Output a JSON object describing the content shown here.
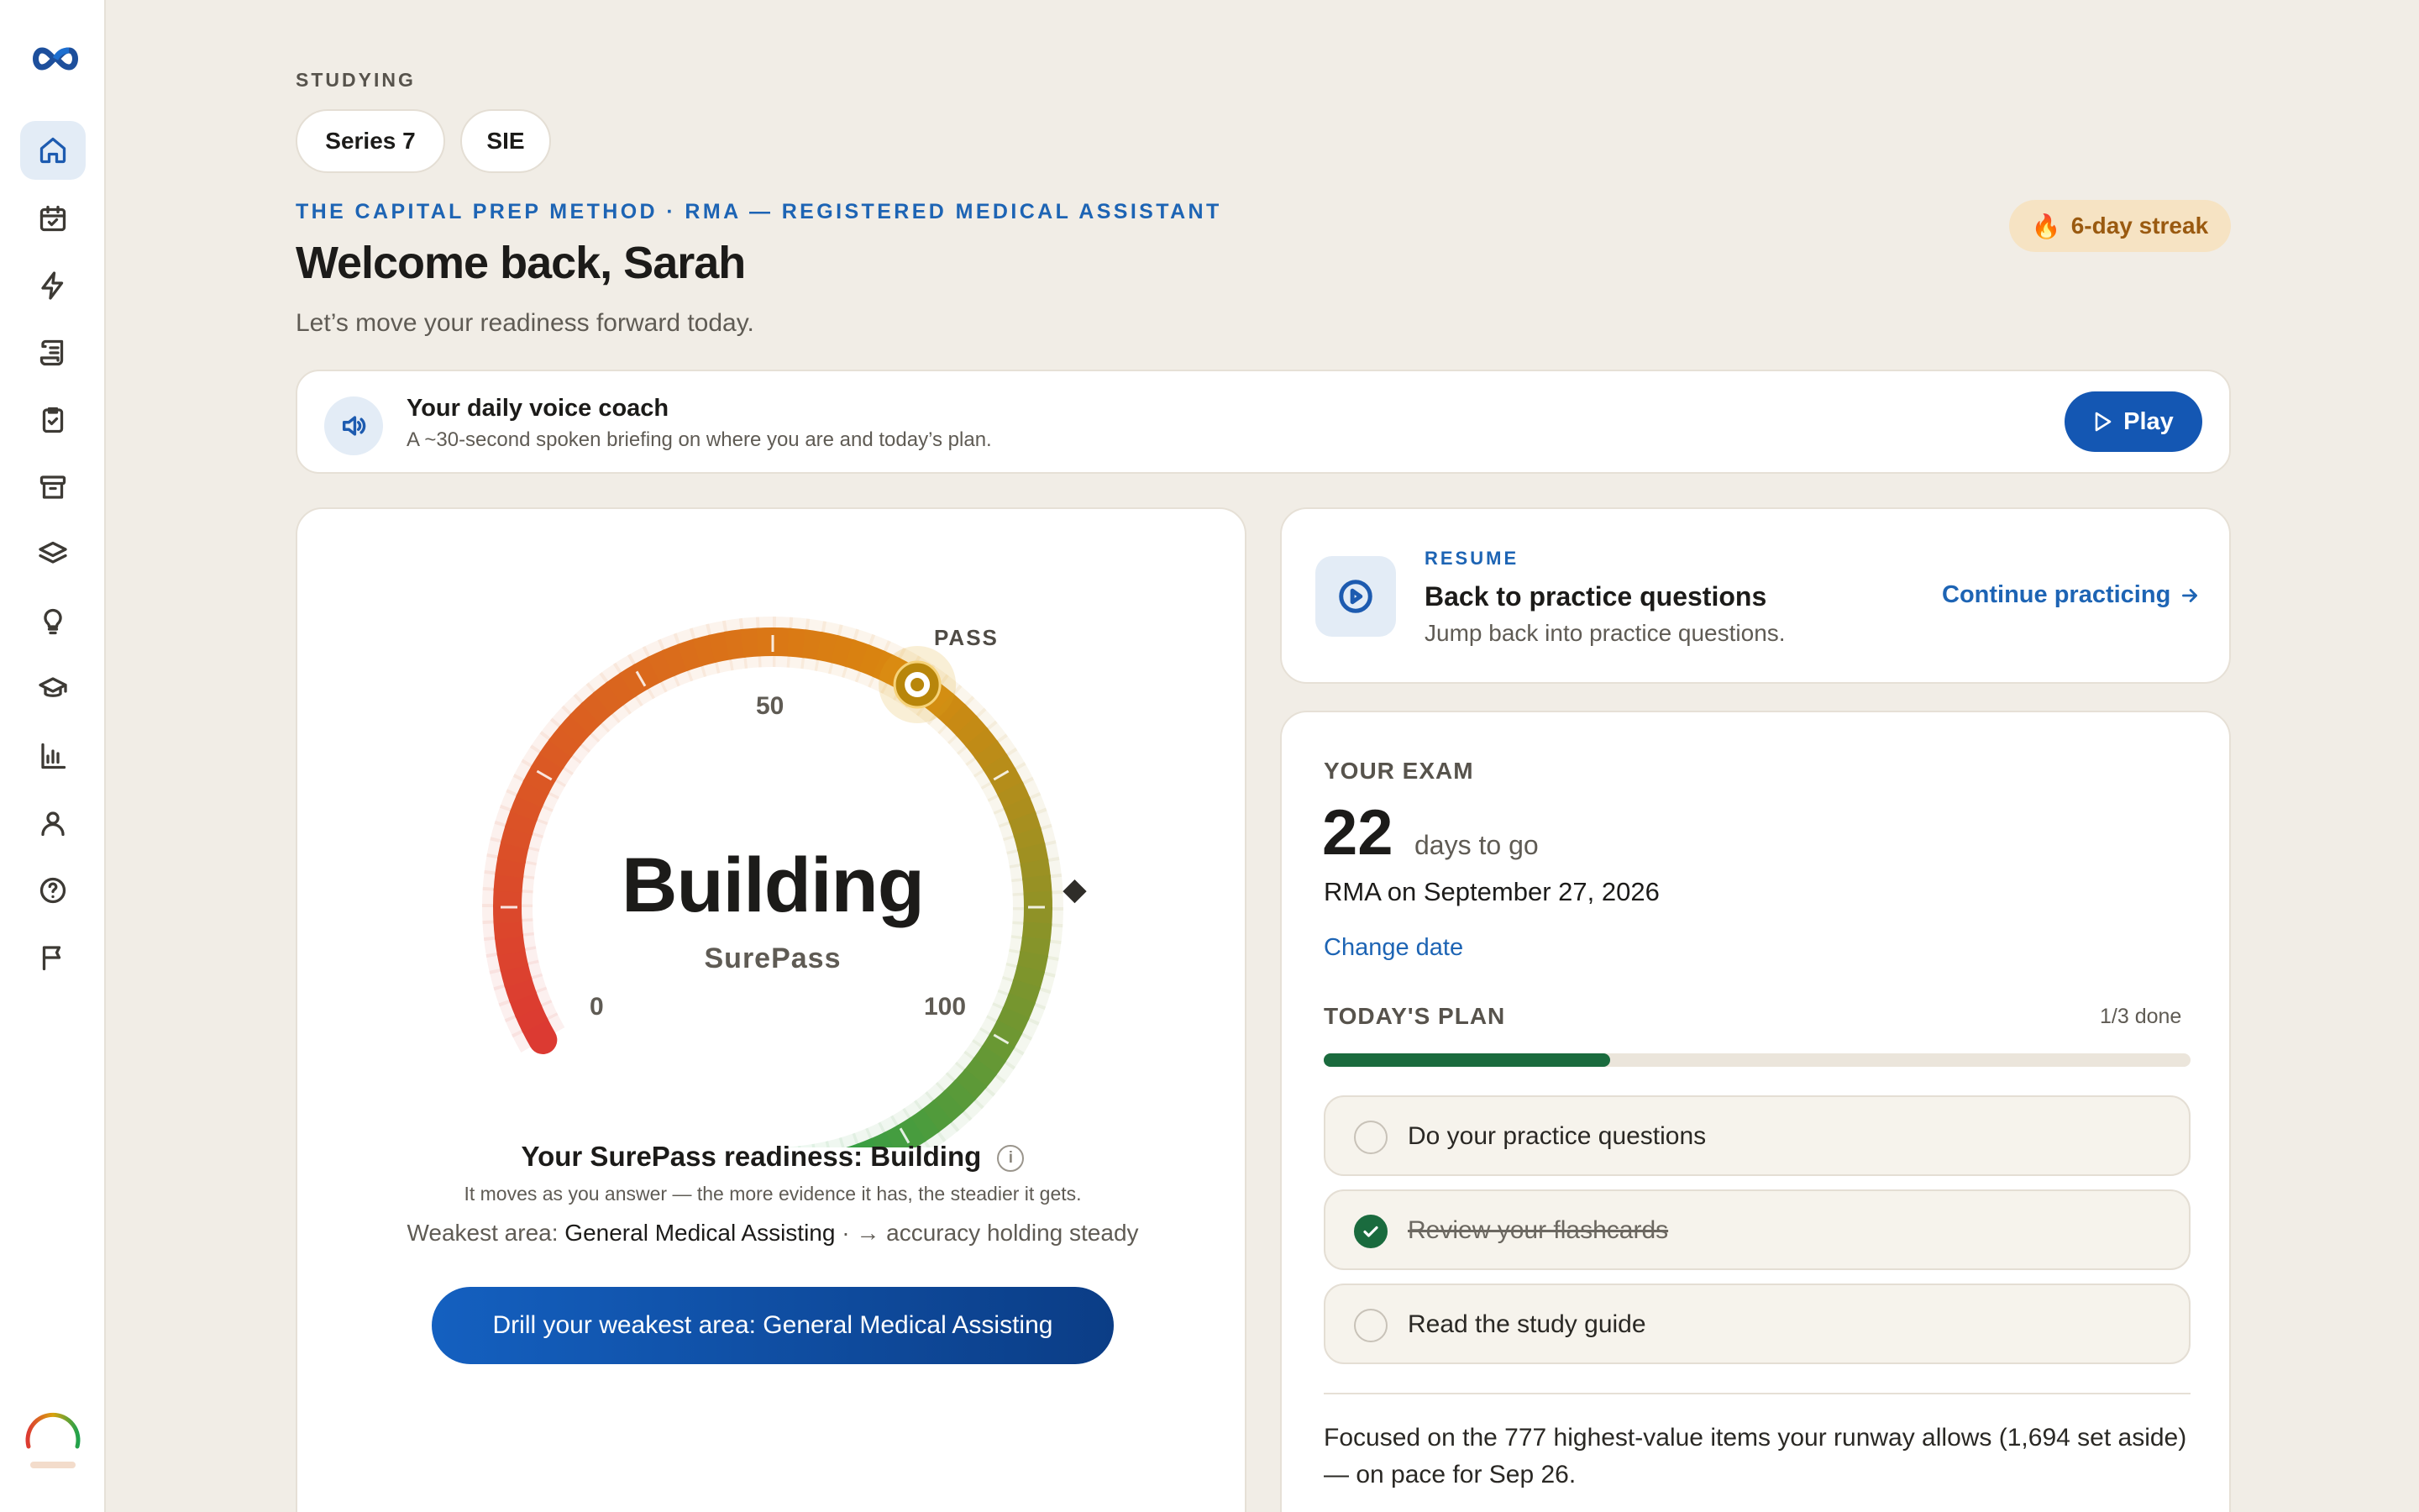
{
  "studying": {
    "label": "STUDYING",
    "chips": [
      "Series 7",
      "SIE"
    ]
  },
  "header": {
    "eyebrow": "THE CAPITAL PREP METHOD · RMA — REGISTERED MEDICAL ASSISTANT",
    "title": "Welcome back, Sarah",
    "subtitle": "Let’s move your readiness forward today.",
    "streak": "6-day streak"
  },
  "voice_coach": {
    "title": "Your daily voice coach",
    "subtitle": "A ~30-second spoken briefing on where you are and today’s plan.",
    "play_label": "Play"
  },
  "readiness": {
    "gauge_word": "Building",
    "gauge_brand": "SurePass",
    "label_min": "0",
    "label_mid": "50",
    "label_max": "100",
    "pass_label": "PASS",
    "score_fraction": 0.51,
    "pass_fraction": 0.69,
    "line_prefix": "Your SurePass readiness:",
    "line_value": "Building",
    "info_glyph": "i",
    "note": "It moves as you answer — the more evidence it has, the steadier it gets.",
    "weakest_prefix": "Weakest area:",
    "weakest_area": "General Medical Assisting",
    "weakest_suffix": "· → accuracy holding steady",
    "drill_button": "Drill your weakest area: General Medical Assisting",
    "colors": {
      "low": "#dc3a32",
      "mid": "#d9880e",
      "high": "#1fa24c"
    }
  },
  "resume": {
    "eyebrow": "RESUME",
    "title": "Back to practice questions",
    "subtitle": "Jump back into practice questions.",
    "link": "Continue practicing"
  },
  "exam": {
    "label": "YOUR EXAM",
    "days": "22",
    "days_label": "days to go",
    "date_line": "RMA on September 27, 2026",
    "change_date": "Change date",
    "plan_label": "TODAY'S PLAN",
    "plan_done": "1/3 done",
    "plan_progress": 0.33,
    "tasks": [
      {
        "label": "Do your practice questions",
        "done": false
      },
      {
        "label": "Review your flashcards",
        "done": true
      },
      {
        "label": "Read the study guide",
        "done": false
      }
    ],
    "focus_text": "Focused on the 777 highest-value items your runway allows (1,694 set aside) — on pace for Sep 26."
  },
  "sidebar": {
    "items": [
      "home-icon",
      "calendar-check-icon",
      "lightning-icon",
      "scroll-icon",
      "clipboard-check-icon",
      "archive-icon",
      "layers-icon",
      "lightbulb-icon",
      "graduation-cap-icon",
      "bar-chart-icon",
      "user-icon",
      "help-circle-icon",
      "flag-icon"
    ],
    "active": "home-icon"
  }
}
